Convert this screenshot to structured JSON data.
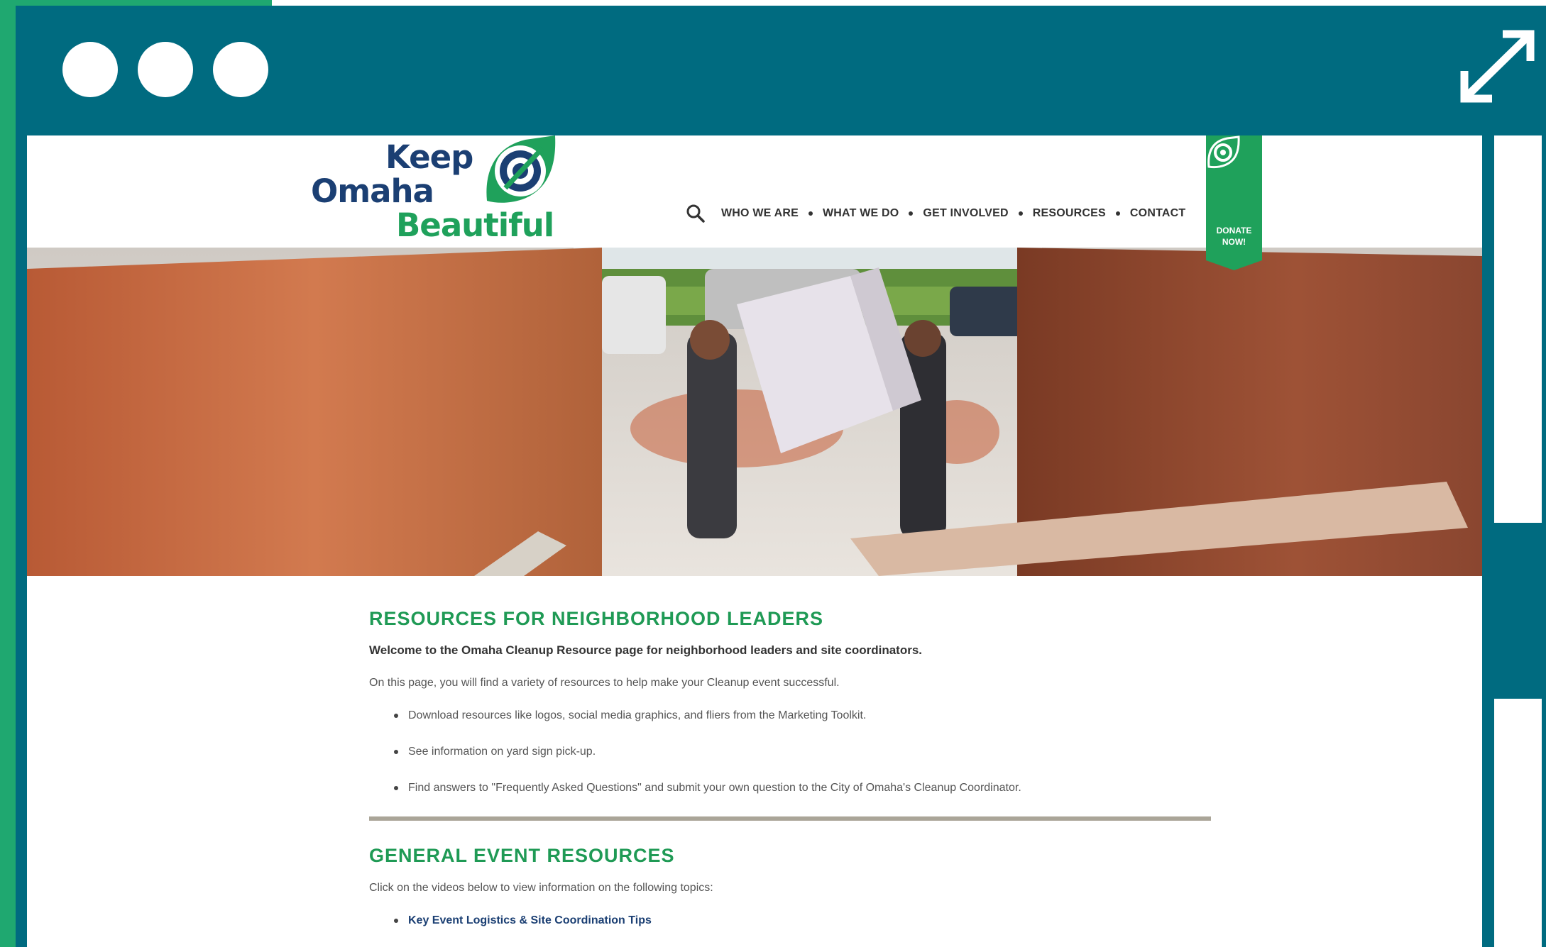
{
  "colors": {
    "frame": "#006b80",
    "accent_green": "#1fa870",
    "heading_green": "#1f9a55",
    "navy": "#1b3f73"
  },
  "logo": {
    "line1": "Keep",
    "line2": "Omaha",
    "line3": "Beautiful"
  },
  "nav": {
    "search_icon": "search-icon",
    "items": [
      "WHO WE ARE",
      "WHAT WE DO",
      "GET INVOLVED",
      "RESOURCES",
      "CONTACT"
    ]
  },
  "donate": {
    "label": "DONATE\nNOW!"
  },
  "content": {
    "heading": "RESOURCES FOR NEIGHBORHOOD LEADERS",
    "intro_bold": "Welcome to the Omaha Cleanup Resource page for neighborhood leaders and site coordinators.",
    "intro": "On this page, you will find a variety of resources to help make your Cleanup event successful.",
    "bullets": [
      "Download resources like logos, social media graphics, and fliers from the Marketing Toolkit.",
      "See information on yard sign pick-up.",
      "Find answers to \"Frequently Asked Questions\" and submit your own question to the City of Omaha's Cleanup Coordinator."
    ],
    "heading2": "GENERAL EVENT RESOURCES",
    "topics_intro": "Click on the videos below to view information on the following topics:",
    "links": [
      "Key Event Logistics & Site Coordination Tips"
    ]
  }
}
